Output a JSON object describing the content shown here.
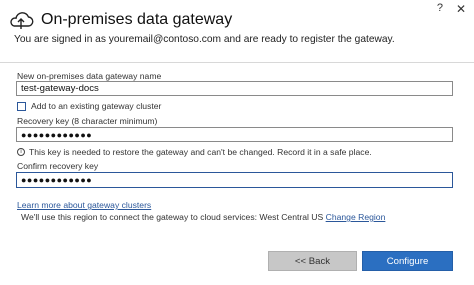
{
  "window": {
    "help_label": "?",
    "close_label": "✕",
    "icon": "cloud-upload-icon"
  },
  "header": {
    "title": "On-premises data gateway",
    "intro": "You are signed in as youremail@contoso.com and are ready to register the gateway."
  },
  "form": {
    "gateway_name_label": "New on-premises data gateway name",
    "gateway_name_value": "test-gateway-docs",
    "add_cluster_label": "Add to an existing gateway cluster",
    "add_cluster_checked": false,
    "recovery_key_label": "Recovery key (8 character minimum)",
    "recovery_key_value": "●●●●●●●●●●●●",
    "info_icon": "info-icon",
    "info_text": "This key is needed to restore the gateway and can't be changed. Record it in a safe place.",
    "confirm_key_label": "Confirm recovery key",
    "confirm_key_value": "●●●●●●●●●●●●"
  },
  "footer": {
    "learn_more_link": "Learn more about gateway clusters",
    "region_text": "We'll use this region to connect the gateway to cloud services: West Central US",
    "change_region_link": "Change Region",
    "back_label": "<< Back",
    "configure_label": "Configure"
  },
  "colors": {
    "accent": "#2b579a",
    "primary_button": "#2b6fc1",
    "secondary_button": "#c7c7c7"
  }
}
